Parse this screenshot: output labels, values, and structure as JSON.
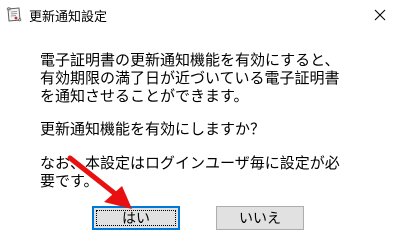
{
  "window": {
    "title": "更新通知設定",
    "icon": "certificate-scroll-icon",
    "close_icon": "close-icon"
  },
  "message": {
    "line1": "電子証明書の更新通知機能を有効にすると、",
    "line2": "有効期限の満了日が近づいている電子証明書",
    "line3": "を通知させることができます。",
    "question": "更新通知機能を有効にしますか？",
    "note_line1": "なお、本設定はログインユーザ毎に設定が必",
    "note_line2": "要です。"
  },
  "buttons": {
    "yes_label": "はい",
    "no_label": "いいえ"
  },
  "annotation": {
    "arrow_color": "#e81010"
  }
}
